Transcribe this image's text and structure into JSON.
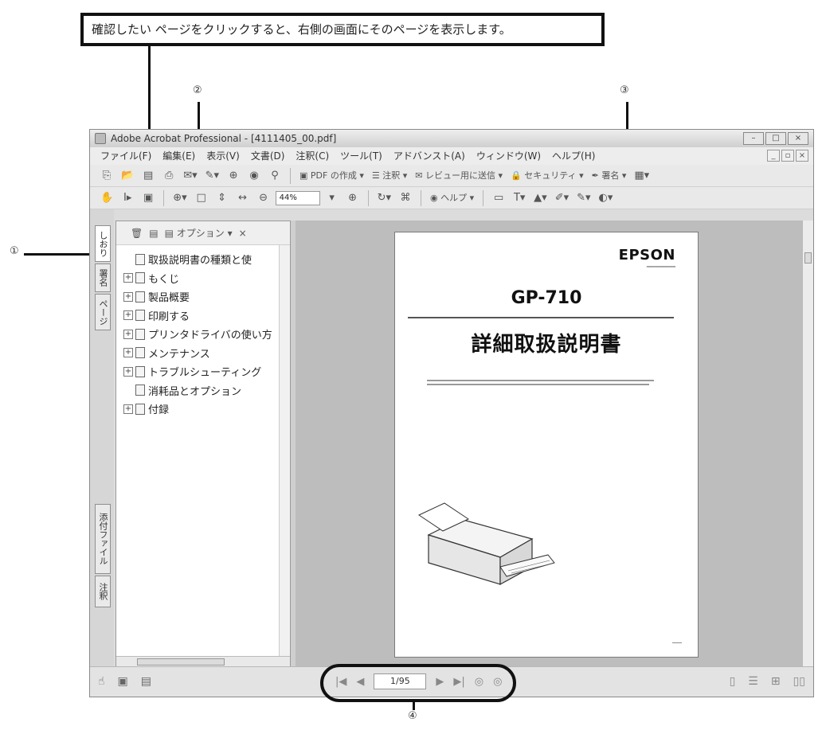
{
  "callouts": {
    "instruction": "確認したい ページをクリックすると、右側の画面にそのページを表示します。",
    "marker_1": "①",
    "marker_2": "②",
    "marker_3": "③",
    "marker_4": "④"
  },
  "window": {
    "title": "Adobe Acrobat Professional - [4111405_00.pdf]",
    "minimize": "–",
    "restore": "□",
    "close": "×"
  },
  "menubar": {
    "items": [
      "ファイル(F)",
      "編集(E)",
      "表示(V)",
      "文書(D)",
      "注釈(C)",
      "ツール(T)",
      "アドバンスト(A)",
      "ウィンドウ(W)",
      "ヘルプ(H)"
    ]
  },
  "toolbar1": {
    "create_pdf": "PDF の作成",
    "comment": "注釈",
    "review": "レビュー用に送信",
    "security": "セキュリティ",
    "sign": "署名"
  },
  "toolbar2": {
    "zoom": "44%",
    "help": "ヘルプ"
  },
  "left_tabs": {
    "bookmarks": "しおり",
    "signatures": "署名",
    "pages": "ページ",
    "attachments": "添付ファイル",
    "comments": "注釈"
  },
  "bookmarks_panel": {
    "options_label": "オプション",
    "close": "×",
    "items": [
      {
        "label": "取扱説明書の種類と使",
        "expandable": false
      },
      {
        "label": "もくじ",
        "expandable": true
      },
      {
        "label": "製品概要",
        "expandable": true
      },
      {
        "label": "印刷する",
        "expandable": true
      },
      {
        "label": "プリンタドライバの使い方",
        "expandable": true
      },
      {
        "label": "メンテナンス",
        "expandable": true
      },
      {
        "label": "トラブルシューティング",
        "expandable": true
      },
      {
        "label": "消耗品とオプション",
        "expandable": false
      },
      {
        "label": "付録",
        "expandable": true
      }
    ]
  },
  "document": {
    "brand": "EPSON",
    "model": "GP-710",
    "title": "詳細取扱説明書"
  },
  "statusbar": {
    "page_field": "1/95"
  },
  "colors": {
    "window_bg": "#dcdcdc",
    "document_bg": "#bdbdbd",
    "callout_border": "#111111"
  }
}
